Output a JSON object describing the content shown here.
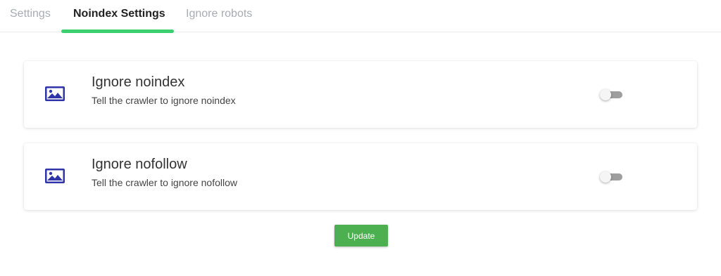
{
  "tabs": [
    {
      "label": "Settings",
      "active": false
    },
    {
      "label": "Noindex Settings",
      "active": true
    },
    {
      "label": "Ignore robots",
      "active": false
    }
  ],
  "accent_color": "#3ccf6f",
  "icon_color": "#2f35a8",
  "settings": [
    {
      "icon": "image-icon",
      "title": "Ignore noindex",
      "description": "Tell the crawler to ignore noindex",
      "enabled": false
    },
    {
      "icon": "image-icon",
      "title": "Ignore nofollow",
      "description": "Tell the crawler to ignore nofollow",
      "enabled": false
    }
  ],
  "update_button": {
    "label": "Update",
    "color": "#4caf50"
  }
}
